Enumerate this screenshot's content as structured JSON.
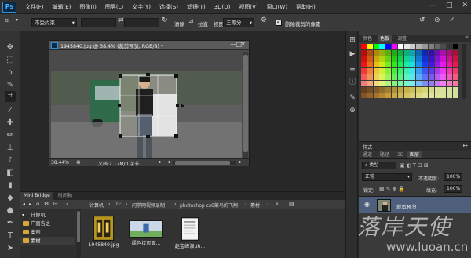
{
  "app": {
    "logo": "Ps",
    "menu": [
      "文件(F)",
      "编辑(E)",
      "图像(I)",
      "图层(L)",
      "文字(Y)",
      "选择(S)",
      "滤镜(T)",
      "3D(D)",
      "视图(V)",
      "窗口(W)",
      "帮助(H)"
    ],
    "window_controls": [
      "—",
      "□",
      "✕"
    ]
  },
  "options": {
    "ratio_preset": "不受约束",
    "clear_label": "清除",
    "straighten_label": "拉直",
    "view_label": "视图:",
    "view_value": "三等分",
    "delete_pixels_label": "删除裁剪的像素",
    "delete_pixels_checked": true
  },
  "document": {
    "title": "1945840.jpg @ 38.4% (裁剪预览, RGB/8) *",
    "zoom": "38.44%",
    "doc_info": "文档:2.17M/0 字节"
  },
  "panels": {
    "color_tabs": [
      "颜色",
      "色板",
      "调整"
    ],
    "color_active": 1,
    "styles_label": "样式",
    "layers_tabs": [
      "通道",
      "路径",
      "3D",
      "图层"
    ],
    "layers_active": 3,
    "kind_label": "类型",
    "blend_mode": "正常",
    "opacity_label": "不透明度:",
    "opacity_value": "100%",
    "lock_label": "锁定:",
    "fill_label": "填充:",
    "fill_value": "100%",
    "layer_name": "裁剪预览"
  },
  "bridge": {
    "tabs": [
      "Mini Bridge",
      "时间轴"
    ],
    "path": [
      "计算机",
      "D:",
      "闪学网视频录制",
      "photoshop cs6菜鸟的飞翔",
      "素材"
    ],
    "tree": [
      "计算机",
      "广而告之",
      "案例",
      "素材"
    ],
    "thumbs": [
      "1945840.jpg",
      "绿色拉页面...",
      "赵宝峰演ph..."
    ]
  },
  "watermark": {
    "brand_cn": "落岸天使",
    "url": "www.luoan.cn"
  },
  "colors": {
    "accent": "#2f8fd8",
    "layer_selected": "#4d5f7a",
    "folder": "#d9a63a"
  }
}
